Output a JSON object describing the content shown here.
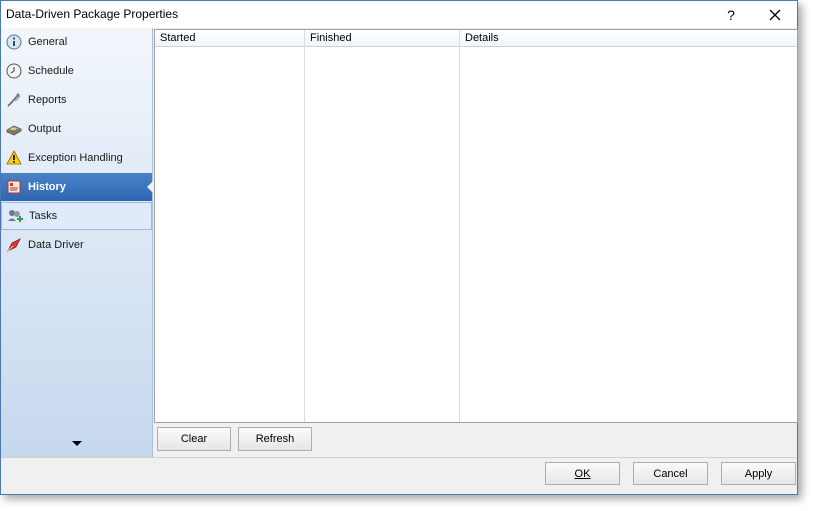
{
  "window": {
    "title": "Data-Driven Package Properties",
    "help_label": "?",
    "close_label": "✕"
  },
  "sidebar": {
    "items": [
      {
        "label": "General",
        "icon": "info-icon"
      },
      {
        "label": "Schedule",
        "icon": "clock-icon"
      },
      {
        "label": "Reports",
        "icon": "reports-icon"
      },
      {
        "label": "Output",
        "icon": "output-icon"
      },
      {
        "label": "Exception Handling",
        "icon": "warning-icon"
      },
      {
        "label": "History",
        "icon": "history-icon",
        "selected": true
      },
      {
        "label": "Tasks",
        "icon": "tasks-icon",
        "hovered": true
      },
      {
        "label": "Data Driver",
        "icon": "data-driver-icon"
      }
    ]
  },
  "history_grid": {
    "columns": [
      "Started",
      "Finished",
      "Details"
    ],
    "rows": []
  },
  "grid_buttons": {
    "clear_label": "Clear",
    "refresh_label": "Refresh"
  },
  "dialog_buttons": {
    "ok_label": "OK",
    "cancel_label": "Cancel",
    "apply_label": "Apply"
  },
  "colors": {
    "selected_item": "#2e67b1",
    "window_border": "#4a78b0"
  }
}
